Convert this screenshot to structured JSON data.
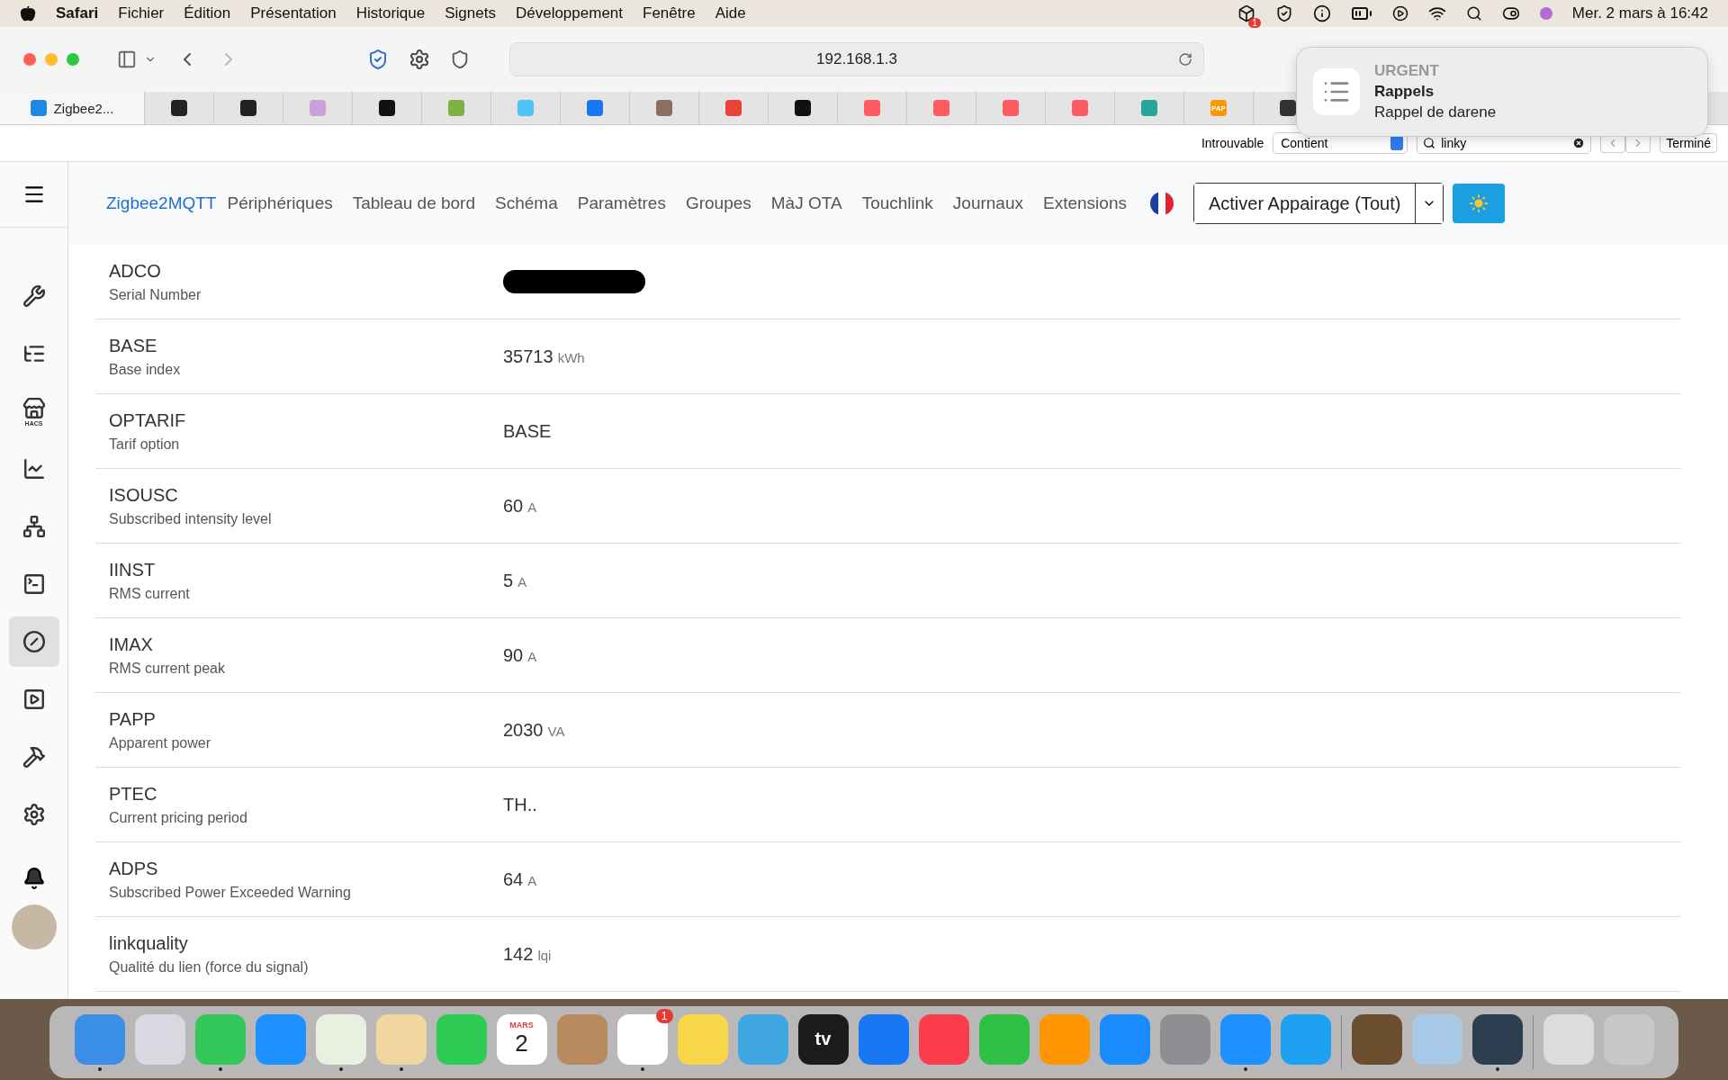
{
  "menu_bar": {
    "app": "Safari",
    "menus": [
      "Fichier",
      "Édition",
      "Présentation",
      "Historique",
      "Signets",
      "Développement",
      "Fenêtre",
      "Aide"
    ],
    "status_badge": "1",
    "clock": "Mer. 2 mars à 16:42"
  },
  "toolbar": {
    "address": "192.168.1.3"
  },
  "tabs": [
    {
      "label": "Zigbee2...",
      "selected": true,
      "color": "#1e88e5"
    },
    {
      "selected": false,
      "color": "#222222"
    },
    {
      "selected": false,
      "color": "#222222"
    },
    {
      "selected": false,
      "color": "#c9a0dc"
    },
    {
      "selected": false,
      "color": "#111111"
    },
    {
      "selected": false,
      "color": "#7cb342"
    },
    {
      "selected": false,
      "color": "#4fc3f7"
    },
    {
      "selected": false,
      "color": "#1877f2"
    },
    {
      "selected": false,
      "color": "#8d6e63"
    },
    {
      "selected": false,
      "color": "#ea4335"
    },
    {
      "selected": false,
      "color": "#111111"
    },
    {
      "selected": false,
      "color": "#ff5a5f"
    },
    {
      "selected": false,
      "color": "#ff5a5f"
    },
    {
      "selected": false,
      "color": "#ff5a5f"
    },
    {
      "selected": false,
      "color": "#ff5a5f"
    },
    {
      "selected": false,
      "color": "#26a69a"
    },
    {
      "selected": false,
      "color": "#ff9800",
      "favicon_text": "PAP"
    },
    {
      "selected": false,
      "color": "#333333"
    }
  ],
  "notification": {
    "tag": "URGENT",
    "app": "Rappels",
    "message": "Rappel de darene"
  },
  "find_bar": {
    "status": "Introuvable",
    "mode": "Contient",
    "query": "linky",
    "done": "Terminé"
  },
  "sidebar": {
    "items": [
      {
        "selected": false
      },
      {
        "selected": false
      },
      {
        "selected": false,
        "caption": "HACS"
      },
      {
        "selected": false
      },
      {
        "selected": false
      },
      {
        "selected": false
      },
      {
        "selected": true
      },
      {
        "selected": false
      },
      {
        "selected": false
      },
      {
        "selected": false
      }
    ]
  },
  "nav": {
    "brand": "Zigbee2MQTT",
    "links": [
      "Périphériques",
      "Tableau de bord",
      "Schéma",
      "Paramètres",
      "Groupes",
      "MàJ OTA",
      "Touchlink",
      "Journaux",
      "Extensions"
    ],
    "pair_button": "Activer Appairage (Tout)"
  },
  "rows": [
    {
      "name": "ADCO",
      "description": "Serial Number",
      "redacted": true
    },
    {
      "name": "BASE",
      "description": "Base index",
      "value": "35713",
      "unit": "kWh",
      "redacted": false
    },
    {
      "name": "OPTARIF",
      "description": "Tarif option",
      "value": "BASE",
      "redacted": false
    },
    {
      "name": "ISOUSC",
      "description": "Subscribed intensity level",
      "value": "60",
      "unit": "A",
      "redacted": false
    },
    {
      "name": "IINST",
      "description": "RMS current",
      "value": "5",
      "unit": "A",
      "redacted": false
    },
    {
      "name": "IMAX",
      "description": "RMS current peak",
      "value": "90",
      "unit": "A",
      "redacted": false
    },
    {
      "name": "PAPP",
      "description": "Apparent power",
      "value": "2030",
      "unit": "VA",
      "redacted": false
    },
    {
      "name": "PTEC",
      "description": "Current pricing period",
      "value": "TH..",
      "redacted": false
    },
    {
      "name": "ADPS",
      "description": "Subscribed Power Exceeded Warning",
      "value": "64",
      "unit": "A",
      "redacted": false
    },
    {
      "name": "linkquality",
      "description": "Qualité du lien (force du signal)",
      "value": "142",
      "unit": "lqi",
      "redacted": false
    }
  ],
  "dock": [
    {
      "kind": "app",
      "color": "#3a8ee6",
      "running": true
    },
    {
      "kind": "app",
      "color": "#d8d8e0",
      "running": false
    },
    {
      "kind": "app",
      "color": "#34c759",
      "running": true
    },
    {
      "kind": "app",
      "color": "#1e90ff",
      "running": false
    },
    {
      "kind": "app",
      "color": "#e8f0e0",
      "running": true
    },
    {
      "kind": "app",
      "color": "#f2d6a0",
      "running": true
    },
    {
      "kind": "app",
      "color": "#2ecc55",
      "running": false
    },
    {
      "kind": "app",
      "color": "#ffffff",
      "running": false,
      "month": "MARS",
      "day": "2"
    },
    {
      "kind": "app",
      "color": "#b98a5e",
      "running": false
    },
    {
      "kind": "app",
      "color": "#ffffff",
      "running": true,
      "badge": "1"
    },
    {
      "kind": "app",
      "color": "#f9d648",
      "running": false
    },
    {
      "kind": "app",
      "color": "#41a5e1",
      "running": false
    },
    {
      "kind": "app",
      "color": "#1c1c1e",
      "running": false,
      "label": "tv"
    },
    {
      "kind": "app",
      "color": "#1877f2",
      "running": false
    },
    {
      "kind": "app",
      "color": "#fa3c4c",
      "running": false
    },
    {
      "kind": "app",
      "color": "#30c048",
      "running": false
    },
    {
      "kind": "app",
      "color": "#ff9500",
      "running": false
    },
    {
      "kind": "app",
      "color": "#1a8cff",
      "running": false
    },
    {
      "kind": "app",
      "color": "#8e8e93",
      "running": false
    },
    {
      "kind": "app",
      "color": "#1e90ff",
      "running": true
    },
    {
      "kind": "app",
      "color": "#1fa1f2",
      "running": false
    },
    {
      "kind": "separator"
    },
    {
      "kind": "app",
      "color": "#6b4e2e",
      "running": false
    },
    {
      "kind": "app",
      "color": "#a8c8e8",
      "running": false
    },
    {
      "kind": "app",
      "color": "#2c3e50",
      "running": true
    },
    {
      "kind": "separator"
    },
    {
      "kind": "app",
      "color": "#dcdcdc",
      "running": false
    },
    {
      "kind": "app",
      "color": "#c8c8c8",
      "running": false
    }
  ]
}
